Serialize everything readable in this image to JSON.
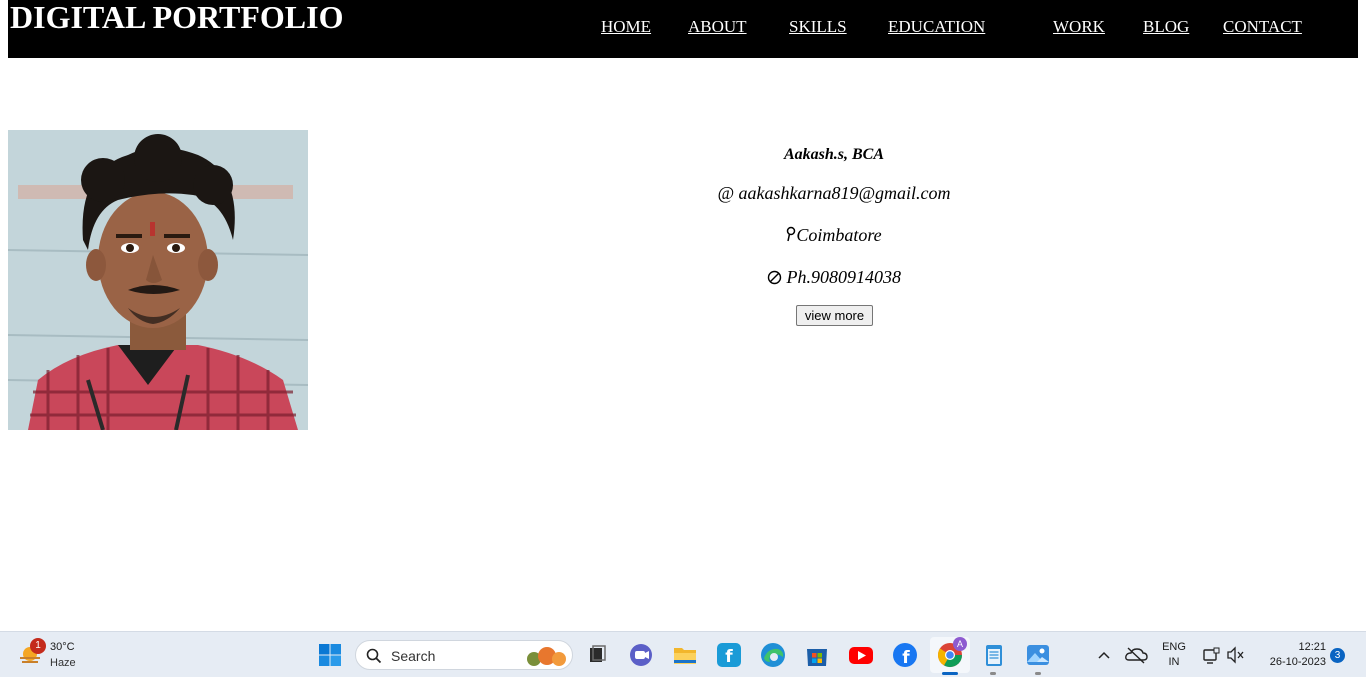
{
  "header": {
    "title": "DIGITAL PORTFOLIO",
    "nav": [
      {
        "label": "HOME"
      },
      {
        "label": "ABOUT"
      },
      {
        "label": "SKILLS"
      },
      {
        "label": "EDUCATION"
      },
      {
        "label": "WORK"
      },
      {
        "label": "BLOG"
      },
      {
        "label": "CONTACT"
      }
    ]
  },
  "profile": {
    "name": "Aakash.s, BCA",
    "email_icon": "@",
    "email": "aakashkarna819@gmail.com",
    "location_icon": "location-pin-icon",
    "location": "Coimbatore",
    "phone_icon": "phone-icon",
    "phone": "Ph.9080914038",
    "view_more_label": "view more"
  },
  "taskbar": {
    "weather_temp": "30°C",
    "weather_condition": "Haze",
    "weather_badge": "1",
    "search_label": "Search",
    "language_line1": "ENG",
    "language_line2": "IN",
    "time": "12:21",
    "date": "26-10-2023",
    "notification_count": "3",
    "chrome_profile_badge": "A"
  },
  "colors": {
    "header_bg": "#000000",
    "header_text": "#ffffff",
    "taskbar_bg": "#e6ecf4"
  }
}
